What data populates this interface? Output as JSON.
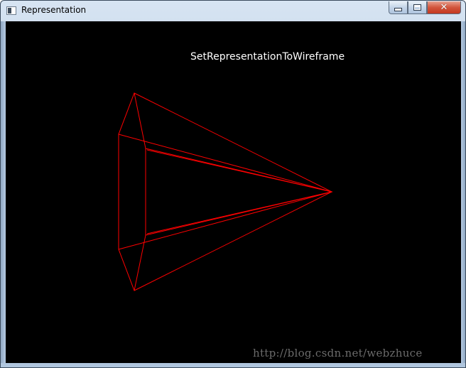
{
  "window": {
    "title": "Representation",
    "icon": "app-window-icon",
    "controls": {
      "minimize_icon": "minimize-icon",
      "maximize_icon": "maximize-icon",
      "close_icon": "close-icon",
      "close_glyph": "✕",
      "close_color": "#c3381f"
    }
  },
  "viewport": {
    "background": "#000000",
    "caption": "SetRepresentationToWireframe",
    "caption_color": "#ffffff",
    "wireframe_color": "#ff0000",
    "shape": "wireframe-cone"
  },
  "watermark": {
    "text": "http://blog.csdn.net/webzhuce"
  }
}
